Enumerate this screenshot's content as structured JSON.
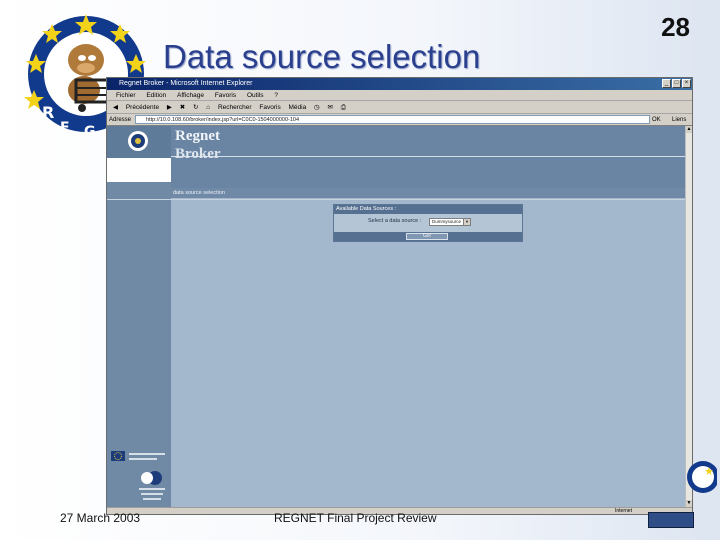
{
  "slide": {
    "title": "Data source selection",
    "number": "28",
    "footer_date": "27 March 2003",
    "footer_title": "REGNET Final Project Review"
  },
  "browser": {
    "window_title": "Regnet Broker - Microsoft Internet Explorer",
    "menu": [
      "Fichier",
      "Edition",
      "Affichage",
      "Favoris",
      "Outils",
      "?"
    ],
    "toolbar": [
      "Précédente",
      "Rechercher",
      "Favoris",
      "Média"
    ],
    "address_label": "Adresse",
    "address_value": "http://10.0.108.60/broker/index.jsp?url=C0C0-1504000000-104",
    "go_label": "OK",
    "links_label": "Liens",
    "status_zone": "Internet"
  },
  "page": {
    "brand_line1": "Regnet",
    "brand_line2": "Broker",
    "breadcrumb": "data source selection",
    "panel_title": "Available Data Sources :",
    "select_label": "Select a data source :",
    "select_value": "Dummysource",
    "go_button": "Go!"
  },
  "colors": {
    "slide_title": "#2b3f8f",
    "page_bg": "#a3b8cc",
    "header_bg": "#6a85a3",
    "panel_header": "#557090"
  }
}
